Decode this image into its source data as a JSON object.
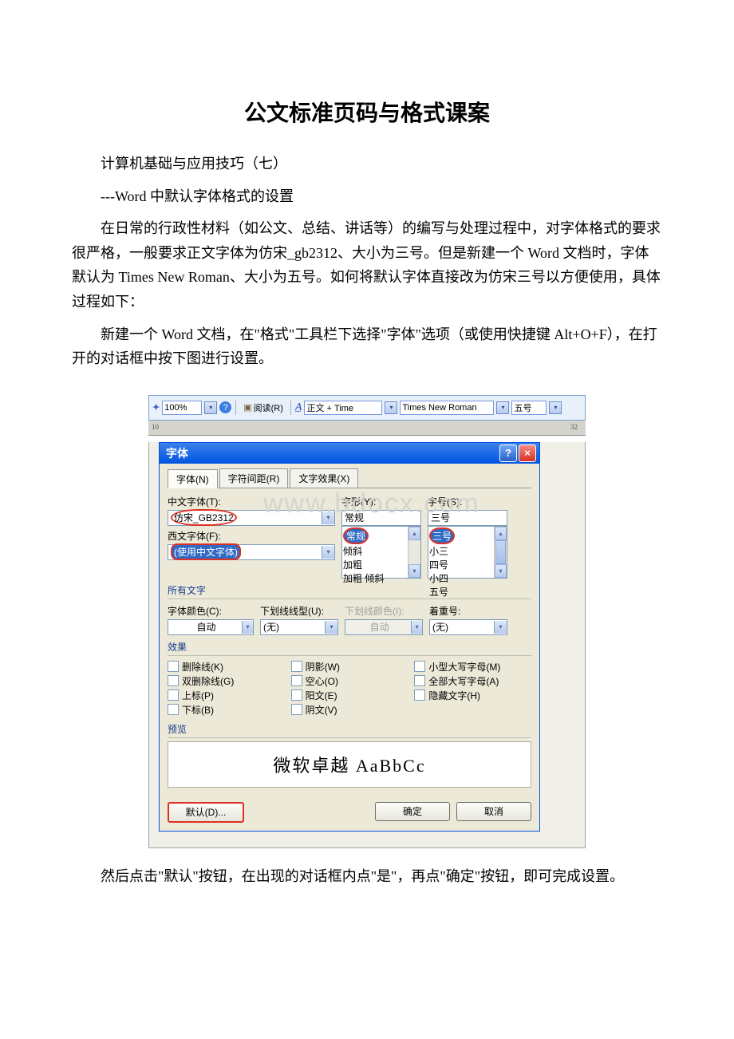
{
  "title": "公文标准页码与格式课案",
  "para1": "计算机基础与应用技巧（七）",
  "para2": "---Word 中默认字体格式的设置",
  "para3": "在日常的行政性材料（如公文、总结、讲话等）的编写与处理过程中，对字体格式的要求很严格，一般要求正文字体为仿宋_gb2312、大小为三号。但是新建一个 Word 文档时，字体默认为 Times New Roman、大小为五号。如何将默认字体直接改为仿宋三号以方便使用，具体过程如下：",
  "para4": "新建一个 Word 文档，在\"格式\"工具栏下选择\"字体\"选项（或使用快捷键 Alt+O+F），在打开的对话框中按下图进行设置。",
  "para5": "然后点击\"默认\"按钮，在出现的对话框内点\"是\"，再点\"确定\"按钮，即可完成设置。",
  "toolbar": {
    "zoom": "100%",
    "read": "阅读(R)",
    "styleLabel": "正文 + Time",
    "fontName": "Times New Roman",
    "fontSize": "五号"
  },
  "ruler": {
    "left": "10",
    "right": "32"
  },
  "dialog": {
    "title": "字体",
    "tabs": {
      "font": "字体(N)",
      "spacing": "字符间距(R)",
      "effects": "文字效果(X)"
    },
    "labels": {
      "cjkFont": "中文字体(T):",
      "latinFont": "西文字体(F):",
      "style": "字形(Y):",
      "size": "字号(S):",
      "allText": "所有文字",
      "color": "字体颜色(C):",
      "underline": "下划线线型(U):",
      "underlineColor": "下划线颜色(I):",
      "emphasis": "着重号:",
      "effects": "效果",
      "preview": "预览"
    },
    "values": {
      "cjkFont": "仿宋_GB2312",
      "latinFont": "(使用中文字体)",
      "style": "常规",
      "sizeSelected": "三号",
      "colorAuto": "自动",
      "underlineNone": "(无)",
      "ulColorAuto": "自动",
      "emphNone": "(无)"
    },
    "styleList": [
      "常规",
      "倾斜",
      "加粗",
      "加粗 倾斜"
    ],
    "sizeList": [
      "三号",
      "小三",
      "四号",
      "小四",
      "五号"
    ],
    "fx": {
      "strike": "删除线(K)",
      "dstrike": "双删除线(G)",
      "sup": "上标(P)",
      "sub": "下标(B)",
      "shadow": "阴影(W)",
      "outline": "空心(O)",
      "emboss": "阳文(E)",
      "engrave": "阴文(V)",
      "smallcaps": "小型大写字母(M)",
      "allcaps": "全部大写字母(A)",
      "hidden": "隐藏文字(H)"
    },
    "previewText": "微软卓越  AaBbCc",
    "buttons": {
      "default": "默认(D)...",
      "ok": "确定",
      "cancel": "取消"
    }
  },
  "watermark": "www.bdocx.com"
}
